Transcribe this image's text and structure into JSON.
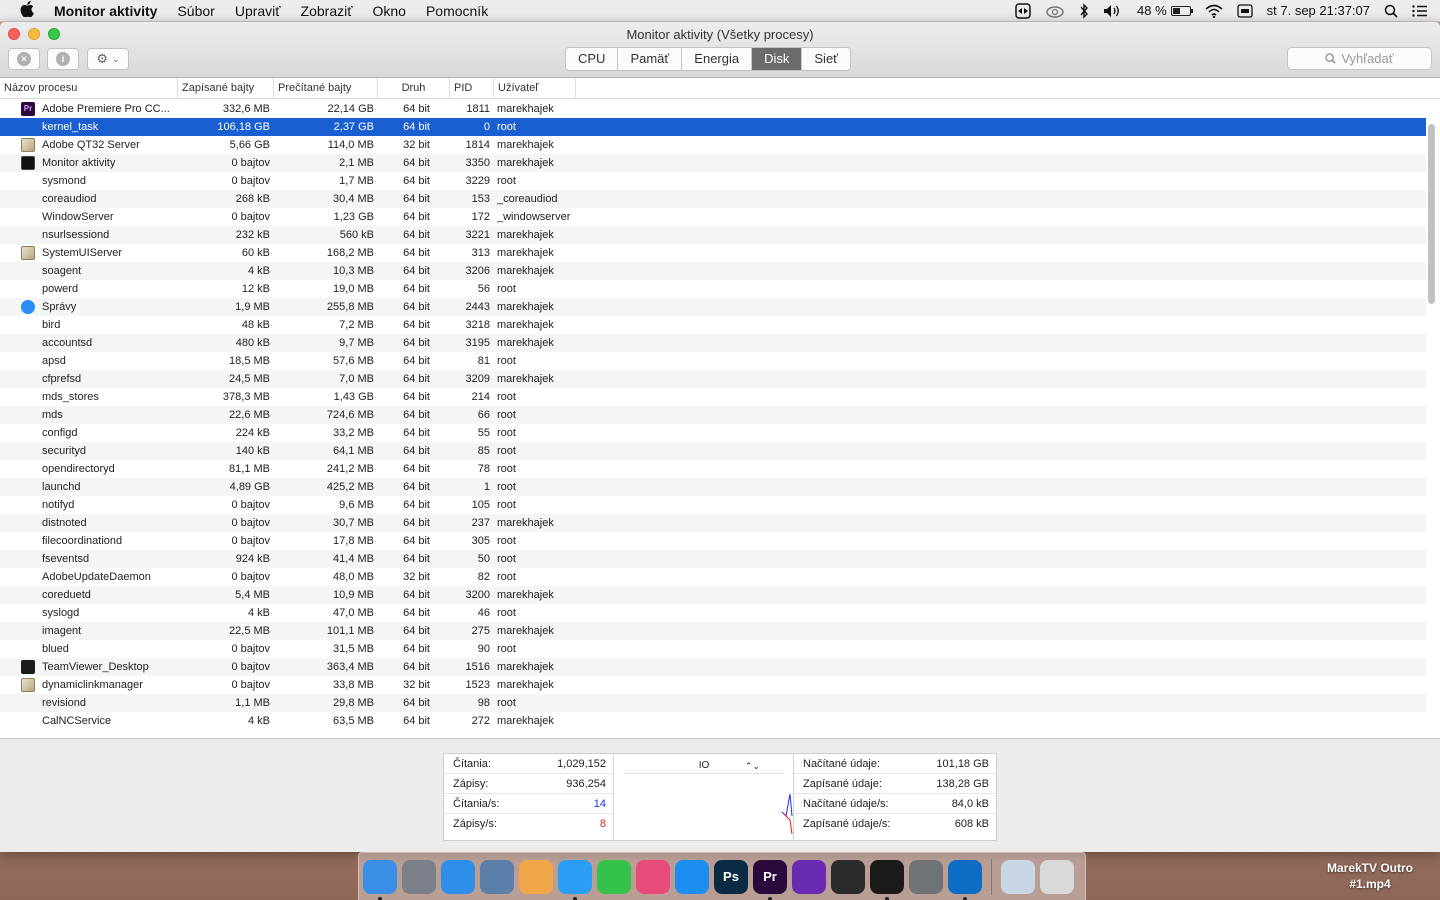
{
  "menubar": {
    "apple": "",
    "app_name": "Monitor aktivity",
    "items": [
      "Súbor",
      "Upraviť",
      "Zobraziť",
      "Okno",
      "Pomocník"
    ],
    "battery": "48 %",
    "battery_level": 0.48,
    "datetime": "st 7. sep  21:37:07"
  },
  "window": {
    "title": "Monitor aktivity (Všetky procesy)",
    "tabs": [
      "CPU",
      "Pamäť",
      "Energia",
      "Disk",
      "Sieť"
    ],
    "active_tab": "Disk",
    "search_placeholder": "Vyhľadať"
  },
  "table": {
    "headers": {
      "name": "Názov procesu",
      "written": "Zapísané bajty",
      "read": "Prečítané bajty",
      "kind": "Druh",
      "pid": "PID",
      "user": "Užívateľ"
    },
    "rows": [
      {
        "icon": "premiere-icon",
        "name": "Adobe Premiere Pro CC...",
        "written": "332,6 MB",
        "read": "22,14 GB",
        "kind": "64 bit",
        "pid": "1811",
        "user": "marekhajek"
      },
      {
        "icon": "",
        "name": "kernel_task",
        "written": "106,18 GB",
        "read": "2,37 GB",
        "kind": "64 bit",
        "pid": "0",
        "user": "root",
        "selected": true
      },
      {
        "icon": "app-icon",
        "name": "Adobe QT32 Server",
        "written": "5,66 GB",
        "read": "114,0 MB",
        "kind": "32 bit",
        "pid": "1814",
        "user": "marekhajek"
      },
      {
        "icon": "activity-monitor-icon",
        "name": "Monitor aktivity",
        "written": "0 bajtov",
        "read": "2,1 MB",
        "kind": "64 bit",
        "pid": "3350",
        "user": "marekhajek"
      },
      {
        "icon": "",
        "name": "sysmond",
        "written": "0 bajtov",
        "read": "1,7 MB",
        "kind": "64 bit",
        "pid": "3229",
        "user": "root"
      },
      {
        "icon": "",
        "name": "coreaudiod",
        "written": "268 kB",
        "read": "30,4 MB",
        "kind": "64 bit",
        "pid": "153",
        "user": "_coreaudiod"
      },
      {
        "icon": "",
        "name": "WindowServer",
        "written": "0 bajtov",
        "read": "1,23 GB",
        "kind": "64 bit",
        "pid": "172",
        "user": "_windowserver"
      },
      {
        "icon": "",
        "name": "nsurlsessiond",
        "written": "232 kB",
        "read": "560 kB",
        "kind": "64 bit",
        "pid": "3221",
        "user": "marekhajek"
      },
      {
        "icon": "app-icon",
        "name": "SystemUIServer",
        "written": "60 kB",
        "read": "168,2 MB",
        "kind": "64 bit",
        "pid": "313",
        "user": "marekhajek"
      },
      {
        "icon": "",
        "name": "soagent",
        "written": "4 kB",
        "read": "10,3 MB",
        "kind": "64 bit",
        "pid": "3206",
        "user": "marekhajek"
      },
      {
        "icon": "",
        "name": "powerd",
        "written": "12 kB",
        "read": "19,0 MB",
        "kind": "64 bit",
        "pid": "56",
        "user": "root"
      },
      {
        "icon": "messages-icon",
        "name": "Správy",
        "written": "1,9 MB",
        "read": "255,8 MB",
        "kind": "64 bit",
        "pid": "2443",
        "user": "marekhajek"
      },
      {
        "icon": "",
        "name": "bird",
        "written": "48 kB",
        "read": "7,2 MB",
        "kind": "64 bit",
        "pid": "3218",
        "user": "marekhajek"
      },
      {
        "icon": "",
        "name": "accountsd",
        "written": "480 kB",
        "read": "9,7 MB",
        "kind": "64 bit",
        "pid": "3195",
        "user": "marekhajek"
      },
      {
        "icon": "",
        "name": "apsd",
        "written": "18,5 MB",
        "read": "57,6 MB",
        "kind": "64 bit",
        "pid": "81",
        "user": "root"
      },
      {
        "icon": "",
        "name": "cfprefsd",
        "written": "24,5 MB",
        "read": "7,0 MB",
        "kind": "64 bit",
        "pid": "3209",
        "user": "marekhajek"
      },
      {
        "icon": "",
        "name": "mds_stores",
        "written": "378,3 MB",
        "read": "1,43 GB",
        "kind": "64 bit",
        "pid": "214",
        "user": "root"
      },
      {
        "icon": "",
        "name": "mds",
        "written": "22,6 MB",
        "read": "724,6 MB",
        "kind": "64 bit",
        "pid": "66",
        "user": "root"
      },
      {
        "icon": "",
        "name": "configd",
        "written": "224 kB",
        "read": "33,2 MB",
        "kind": "64 bit",
        "pid": "55",
        "user": "root"
      },
      {
        "icon": "",
        "name": "securityd",
        "written": "140 kB",
        "read": "64,1 MB",
        "kind": "64 bit",
        "pid": "85",
        "user": "root"
      },
      {
        "icon": "",
        "name": "opendirectoryd",
        "written": "81,1 MB",
        "read": "241,2 MB",
        "kind": "64 bit",
        "pid": "78",
        "user": "root"
      },
      {
        "icon": "",
        "name": "launchd",
        "written": "4,89 GB",
        "read": "425,2 MB",
        "kind": "64 bit",
        "pid": "1",
        "user": "root"
      },
      {
        "icon": "",
        "name": "notifyd",
        "written": "0 bajtov",
        "read": "9,6 MB",
        "kind": "64 bit",
        "pid": "105",
        "user": "root"
      },
      {
        "icon": "",
        "name": "distnoted",
        "written": "0 bajtov",
        "read": "30,7 MB",
        "kind": "64 bit",
        "pid": "237",
        "user": "marekhajek"
      },
      {
        "icon": "",
        "name": "filecoordinationd",
        "written": "0 bajtov",
        "read": "17,8 MB",
        "kind": "64 bit",
        "pid": "305",
        "user": "root"
      },
      {
        "icon": "",
        "name": "fseventsd",
        "written": "924 kB",
        "read": "41,4 MB",
        "kind": "64 bit",
        "pid": "50",
        "user": "root"
      },
      {
        "icon": "",
        "name": "AdobeUpdateDaemon",
        "written": "0 bajtov",
        "read": "48,0 MB",
        "kind": "32 bit",
        "pid": "82",
        "user": "root"
      },
      {
        "icon": "",
        "name": "coreduetd",
        "written": "5,4 MB",
        "read": "10,9 MB",
        "kind": "64 bit",
        "pid": "3200",
        "user": "marekhajek"
      },
      {
        "icon": "",
        "name": "syslogd",
        "written": "4 kB",
        "read": "47,0 MB",
        "kind": "64 bit",
        "pid": "46",
        "user": "root"
      },
      {
        "icon": "",
        "name": "imagent",
        "written": "22,5 MB",
        "read": "101,1 MB",
        "kind": "64 bit",
        "pid": "275",
        "user": "marekhajek"
      },
      {
        "icon": "",
        "name": "blued",
        "written": "0 bajtov",
        "read": "31,5 MB",
        "kind": "64 bit",
        "pid": "90",
        "user": "root"
      },
      {
        "icon": "teamviewer-icon",
        "name": "TeamViewer_Desktop",
        "written": "0 bajtov",
        "read": "363,4 MB",
        "kind": "64 bit",
        "pid": "1516",
        "user": "marekhajek"
      },
      {
        "icon": "app-icon",
        "name": "dynamiclinkmanager",
        "written": "0 bajtov",
        "read": "33,8 MB",
        "kind": "32 bit",
        "pid": "1523",
        "user": "marekhajek"
      },
      {
        "icon": "",
        "name": "revisiond",
        "written": "1,1 MB",
        "read": "29,8 MB",
        "kind": "64 bit",
        "pid": "98",
        "user": "root"
      },
      {
        "icon": "",
        "name": "CalNCService",
        "written": "4 kB",
        "read": "63,5 MB",
        "kind": "64 bit",
        "pid": "272",
        "user": "marekhajek"
      }
    ]
  },
  "stats": {
    "reads_label": "Čítania:",
    "reads": "1,029,152",
    "writes_label": "Zápisy:",
    "writes": "936,254",
    "reads_s_label": "Čítania/s:",
    "reads_s": "14",
    "writes_s_label": "Zápisy/s:",
    "writes_s": "8",
    "graph_select": "IO",
    "data_read_label": "Načítané údaje:",
    "data_read": "101,18 GB",
    "data_written_label": "Zapísané údaje:",
    "data_written": "138,28 GB",
    "data_read_s_label": "Načítané údaje/s:",
    "data_read_s": "84,0 kB",
    "data_written_s_label": "Zapísané údaje/s:",
    "data_written_s": "608 kB",
    "colors": {
      "reads": "#1f2de0",
      "writes": "#e02020"
    }
  },
  "dock": {
    "apps": [
      {
        "name": "finder-icon",
        "label": "",
        "color": "#3a8ee6",
        "running": true
      },
      {
        "name": "launchpad-icon",
        "label": "",
        "color": "#7a7f8a",
        "running": false
      },
      {
        "name": "safari-icon",
        "label": "",
        "color": "#2f8fe8",
        "running": false
      },
      {
        "name": "preview-icon",
        "label": "",
        "color": "#5a7fa8",
        "running": false
      },
      {
        "name": "photos-icon",
        "label": "",
        "color": "#f2a64a",
        "running": false
      },
      {
        "name": "messages-icon",
        "label": "",
        "color": "#2a9df4",
        "running": true
      },
      {
        "name": "facetime-icon",
        "label": "",
        "color": "#34c24a",
        "running": false
      },
      {
        "name": "itunes-icon",
        "label": "",
        "color": "#e64b7a",
        "running": false
      },
      {
        "name": "appstore-icon",
        "label": "",
        "color": "#1c8ef0",
        "running": false
      },
      {
        "name": "photoshop-icon",
        "label": "Ps",
        "color": "#0b2a44",
        "running": false
      },
      {
        "name": "premiere-icon",
        "label": "Pr",
        "color": "#2a0a3d",
        "running": true
      },
      {
        "name": "imovie-icon",
        "label": "",
        "color": "#6a2bb3",
        "running": false
      },
      {
        "name": "obs-icon",
        "label": "",
        "color": "#2b2b2b",
        "running": false
      },
      {
        "name": "activity-monitor-icon",
        "label": "",
        "color": "#1a1a1a",
        "running": true
      },
      {
        "name": "system-preferences-icon",
        "label": "",
        "color": "#6f7378",
        "running": false
      },
      {
        "name": "teamviewer-icon",
        "label": "",
        "color": "#0e6cc4",
        "running": true
      },
      {
        "name": "downloads-stack-icon",
        "label": "",
        "color": "#c9d6e6",
        "running": false
      },
      {
        "name": "trash-icon",
        "label": "",
        "color": "#d9d9d9",
        "running": false
      }
    ]
  },
  "desktop": {
    "file_label_1": "MarekTV Outro",
    "file_label_2": "#1.mp4"
  }
}
